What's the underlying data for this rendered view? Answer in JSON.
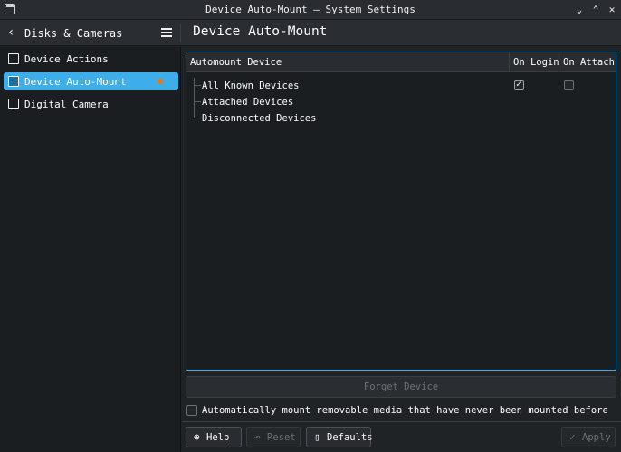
{
  "window": {
    "title": "Device Auto-Mount — System Settings",
    "controls": [
      "chevron-down-icon",
      "chevron-up-icon",
      "close-icon"
    ]
  },
  "header": {
    "left_title": "Disks & Cameras",
    "page_title": "Device Auto-Mount"
  },
  "sidebar": {
    "items": [
      {
        "label": "Device Actions",
        "icon": "device-actions-icon",
        "active": false
      },
      {
        "label": "Device Auto-Mount",
        "icon": "usb-device-icon",
        "active": true,
        "modified": true
      },
      {
        "label": "Digital Camera",
        "icon": "camera-icon",
        "active": false
      }
    ]
  },
  "device_table": {
    "columns": [
      "Automount Device",
      "On Login",
      "On Attach"
    ],
    "rows": [
      {
        "label": "All Known Devices",
        "on_login": true,
        "on_attach": false
      },
      {
        "label": "Attached Devices"
      },
      {
        "label": "Disconnected Devices"
      }
    ]
  },
  "actions": {
    "forget_label": "Forget Device",
    "auto_mount_label": "Automatically mount removable media that have never been mounted before",
    "auto_mount_checked": false
  },
  "footer": {
    "help_label": "Help",
    "reset_label": "Reset",
    "defaults_label": "Defaults",
    "apply_label": "Apply"
  },
  "colors": {
    "accent": "#3daee9",
    "modified_dot": "#f67400",
    "background": "#202326"
  }
}
